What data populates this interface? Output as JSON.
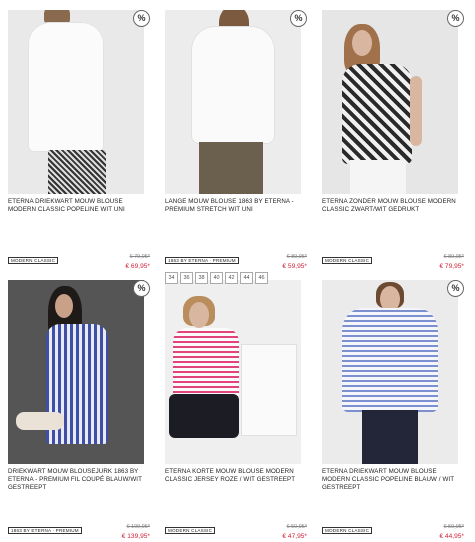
{
  "products": [
    {
      "title": "ETERNA DRIEKWART MOUW BLOUSE MODERN CLASSIC POPELINE WIT UNI",
      "badge": "MODERN CLASSIC",
      "price_old": "€ 79,95*",
      "price_new": "€ 69,95*",
      "wishlist": "%"
    },
    {
      "title": "LANGE MOUW BLOUSE 1863 BY ETERNA - PREMIUM STRETCH WIT UNI",
      "badge": "1863 BY ETERNA · PREMIUM",
      "price_old": "€ 89,95*",
      "price_new": "€ 59,95*",
      "wishlist": "%"
    },
    {
      "title": "ETERNA ZONDER MOUW BLOUSE MODERN CLASSIC ZWART/WIT GEDRUKT",
      "badge": "MODERN CLASSIC",
      "price_old": "€ 89,95*",
      "price_new": "€ 79,95*",
      "wishlist": "%"
    },
    {
      "title": "DRIEKWART MOUW BLOUSEJURK 1863 BY ETERNA - PREMIUM FIL COUPÉ BLAUW/WIT GESTREEPT",
      "badge": "1863 BY ETERNA · PREMIUM",
      "price_old": "€ 199,95*",
      "price_new": "€ 139,95*",
      "wishlist": "%"
    },
    {
      "title": "ETERNA KORTE MOUW BLOUSE MODERN CLASSIC JERSEY ROZE / WIT GESTREEPT",
      "badge": "MODERN CLASSIC",
      "price_old": "€ 59,95*",
      "price_new": "€ 47,95*",
      "sizes": [
        "34",
        "36",
        "38",
        "40",
        "42",
        "44",
        "46"
      ]
    },
    {
      "title": "ETERNA DRIEKWART MOUW BLOUSE MODERN CLASSIC POPELINE BLAUW / WIT GESTREEPT",
      "badge": "MODERN CLASSIC",
      "price_old": "€ 59,95*",
      "price_new": "€ 44,95*",
      "wishlist": "%"
    }
  ],
  "colors": {
    "sale_price": "#d2233b",
    "old_price": "#888888",
    "image_bg": "#eeeeee"
  }
}
